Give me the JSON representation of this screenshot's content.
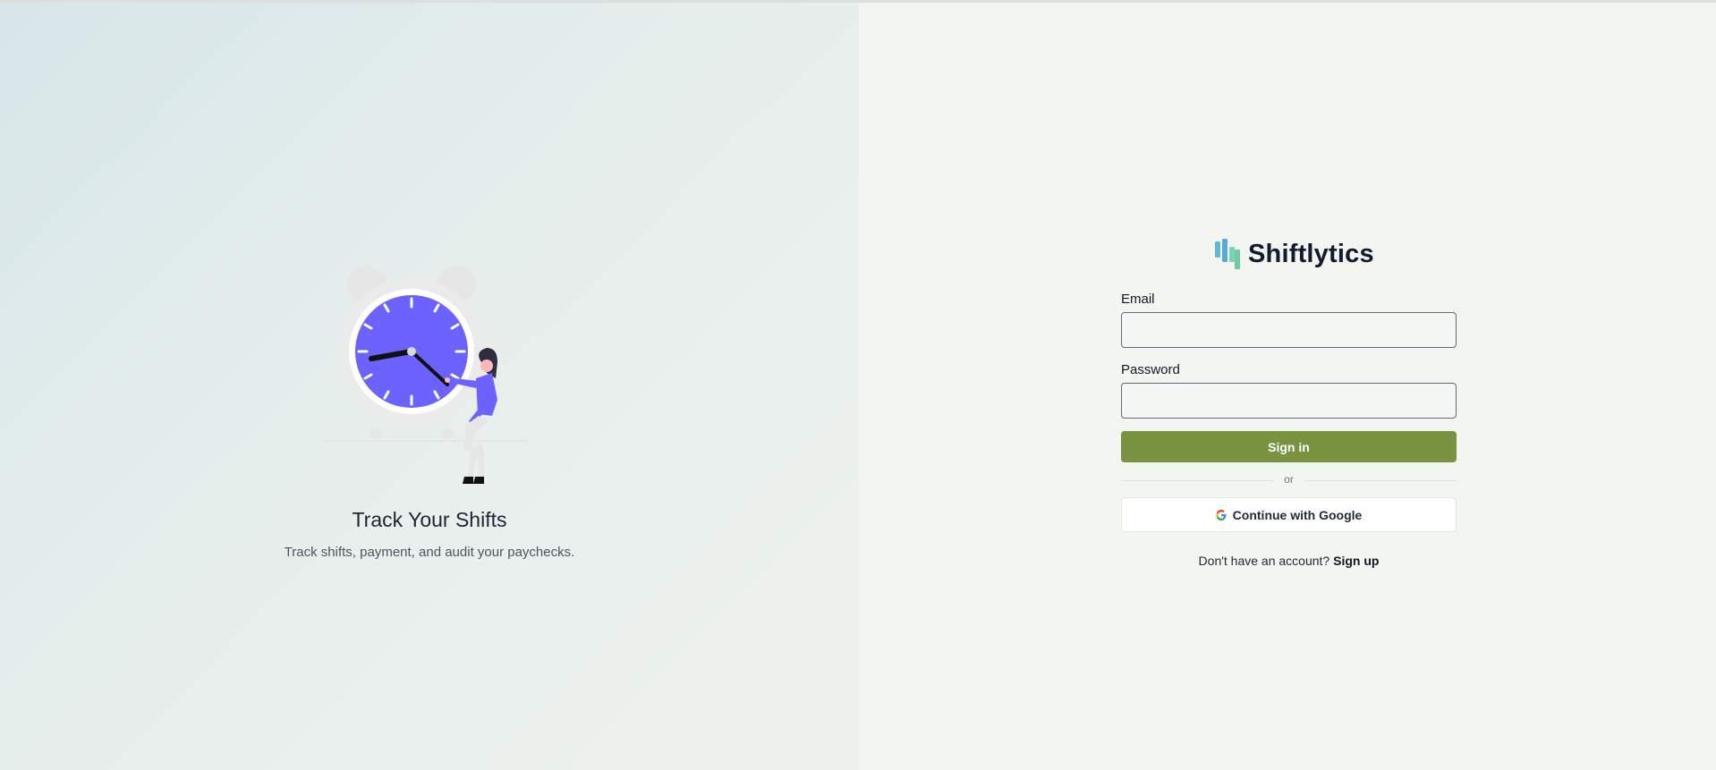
{
  "hero": {
    "title": "Track Your Shifts",
    "subtitle": "Track shifts, payment, and audit your paychecks."
  },
  "brand": {
    "name": "Shiftlytics",
    "icon": "bar-chart-logo-icon"
  },
  "form": {
    "email_label": "Email",
    "email_value": "",
    "password_label": "Password",
    "password_value": "",
    "signin_label": "Sign in",
    "divider_text": "or",
    "google_label": "Continue with Google",
    "signup_prompt": "Don't have an account?",
    "signup_link": "Sign up"
  },
  "colors": {
    "accent": "#7a9340",
    "clock": "#6c63ff",
    "brand_text": "#121a2e"
  }
}
